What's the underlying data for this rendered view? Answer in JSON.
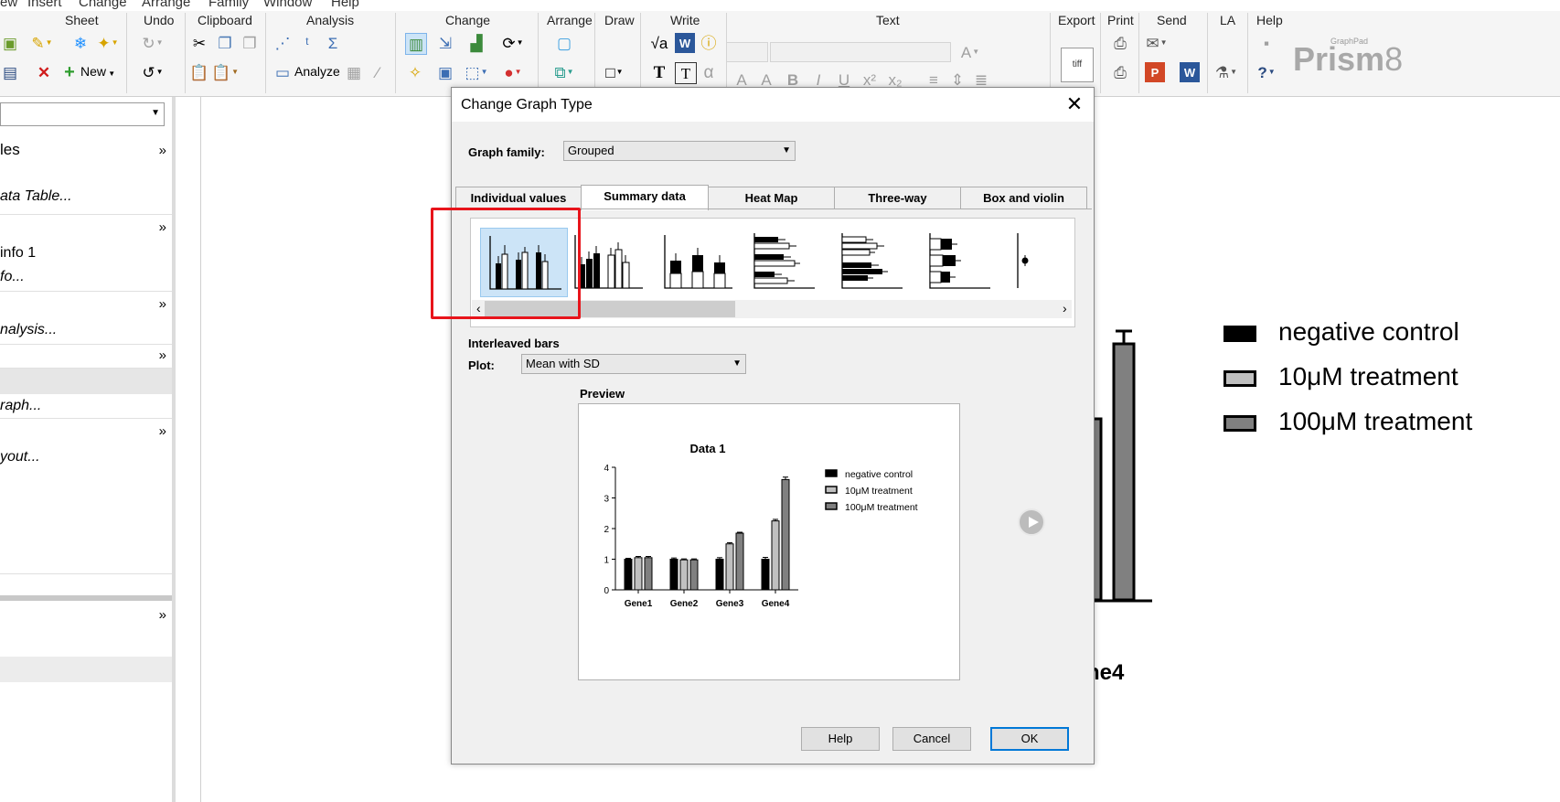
{
  "menubar": [
    "ew",
    "Insert",
    "Change",
    "Arrange",
    "Family",
    "Window",
    "Help"
  ],
  "ribbon": {
    "groups": [
      "Sheet",
      "Undo",
      "Clipboard",
      "Analysis",
      "Change",
      "Arrange",
      "Draw",
      "Write",
      "Text",
      "Export",
      "Print",
      "Send",
      "LA",
      "Help"
    ],
    "new_label": "New",
    "analyze_label": "Analyze",
    "brand_small": "GraphPad",
    "brand": "Prism",
    "brand_version": "8"
  },
  "left_panel": {
    "rows": [
      "les",
      "ata Table...",
      "info 1",
      "fo...",
      "nalysis...",
      "raph...",
      "yout..."
    ]
  },
  "background_graph": {
    "legend": [
      "negative control",
      "10μM treatment",
      "100μM treatment"
    ],
    "x_label_fragment": "ne4"
  },
  "dialog": {
    "title": "Change Graph Type",
    "graph_family_label": "Graph family:",
    "graph_family_value": "Grouped",
    "tabs": [
      "Individual values",
      "Summary data",
      "Heat Map",
      "Three-way",
      "Box and violin"
    ],
    "active_tab": "Summary data",
    "selected_type": "Interleaved bars",
    "plot_label": "Plot:",
    "plot_value": "Mean with SD",
    "preview_label": "Preview",
    "buttons": {
      "help": "Help",
      "cancel": "Cancel",
      "ok": "OK"
    }
  },
  "chart_data": {
    "type": "bar",
    "title": "Data 1",
    "categories": [
      "Gene1",
      "Gene2",
      "Gene3",
      "Gene4"
    ],
    "series": [
      {
        "name": "negative control",
        "values": [
          1.0,
          1.0,
          1.0,
          1.0
        ],
        "sd": [
          0.03,
          0.04,
          0.05,
          0.06
        ],
        "color": "#000000"
      },
      {
        "name": "10μM treatment",
        "values": [
          1.05,
          0.98,
          1.5,
          2.25
        ],
        "sd": [
          0.04,
          0.03,
          0.04,
          0.05
        ],
        "color": "#c0c0c0"
      },
      {
        "name": "100μM treatment",
        "values": [
          1.05,
          0.98,
          1.85,
          3.6
        ],
        "sd": [
          0.04,
          0.03,
          0.03,
          0.08
        ],
        "color": "#808080"
      }
    ],
    "ylim": [
      0,
      4
    ],
    "yticks": [
      0,
      1,
      2,
      3,
      4
    ],
    "legend_position": "right"
  }
}
